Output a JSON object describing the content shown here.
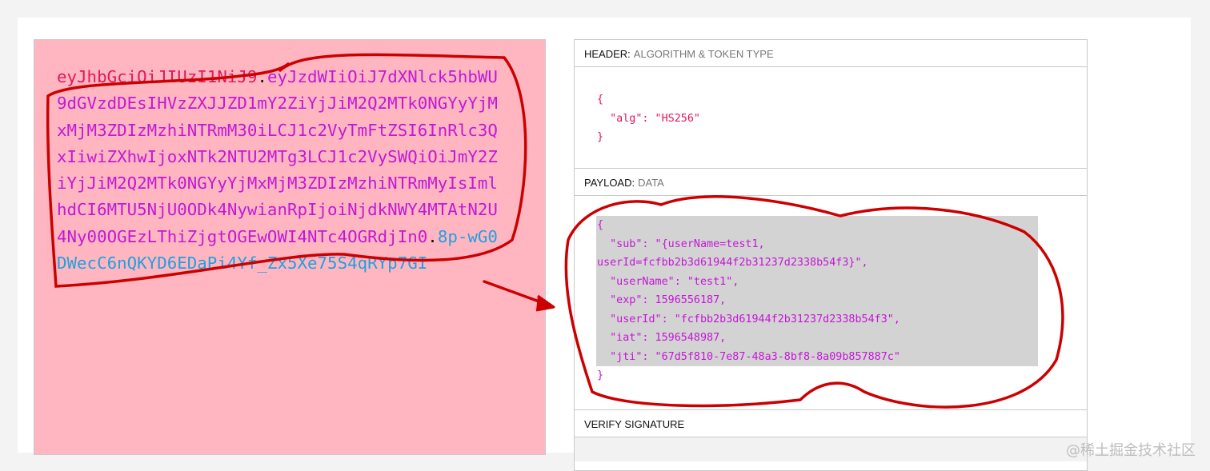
{
  "encoded": {
    "header": "eyJhbGciOiJIUzI1NiJ9",
    "dot1": ".",
    "payload": "eyJzdWIiOiJ7dXNlck5hbWU9dGVzdDEsIHVzZXJJZD1mY2ZiYjJiM2Q2MTk0NGYyYjMxMjM3ZDIzMzhiNTRmM30iLCJ1c2VyTmFtZSI6InRlc3QxIiwiZXhwIjoxNTk2NTU2MTg3LCJ1c2VySWQiOiJmY2ZiYjJiM2Q2MTk0NGYyYjMxMjM3ZDIzMzhiNTRmMyIsImlhdCI6MTU5NjU0ODk4NywianRpIjoiNjdkNWY4MTAtN2U4Ny00OGEzLThiZjgtOGEwOWI4NTc4OGRdjIn0",
    "dot2": ".",
    "signature": "8p-wG0DWecC6nQKYD6EDaPi4Yf_Zx5Xe75S4qRYp7GI"
  },
  "header_section": {
    "title": "HEADER:",
    "subtitle": "ALGORITHM & TOKEN TYPE",
    "json": "{\n  \"alg\": \"HS256\"\n}"
  },
  "payload_section": {
    "title": "PAYLOAD:",
    "subtitle": "DATA",
    "json": "{\n  \"sub\": \"{userName=test1,\nuserId=fcfbb2b3d61944f2b31237d2338b54f3}\",\n  \"userName\": \"test1\",\n  \"exp\": 1596556187,\n  \"userId\": \"fcfbb2b3d61944f2b31237d2338b54f3\",\n  \"iat\": 1596548987,\n  \"jti\": \"67d5f810-7e87-48a3-8bf8-8a09b857887c\"\n}"
  },
  "verify_section": {
    "title": "VERIFY SIGNATURE"
  },
  "watermark": "@稀土掘金技术社区",
  "colors": {
    "header_text": "#e0185c",
    "payload_text": "#c417d6",
    "signature_text": "#21a0e0",
    "annotation_red": "#cc0000",
    "encoded_bg": "#ffb6c1"
  }
}
